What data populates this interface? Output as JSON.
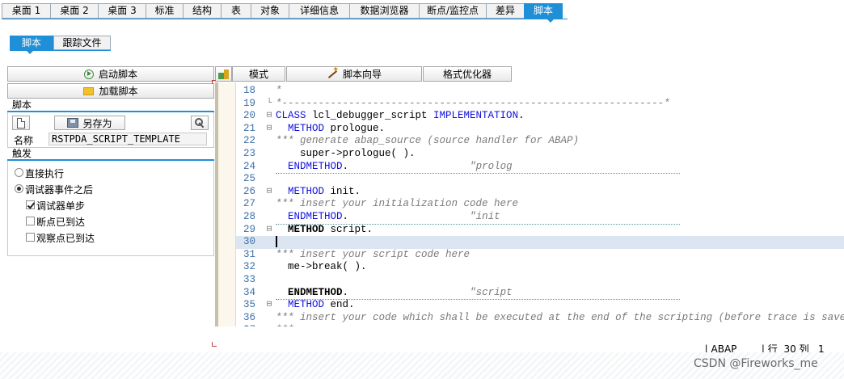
{
  "top_tabs": [
    "桌面 1",
    "桌面 2",
    "桌面 3",
    "标准",
    "结构",
    "表",
    "对象",
    "详细信息",
    "数据浏览器",
    "断点/监控点",
    "差异",
    "脚本"
  ],
  "top_tabs_active": "脚本",
  "sub_tabs": [
    "脚本",
    "跟踪文件"
  ],
  "sub_tabs_active": "脚本",
  "left": {
    "start_button": "启动脚本",
    "load_button": "加载脚本",
    "script_group": "脚本",
    "save_as_button": "另存为",
    "name_label": "名称",
    "name_value": "RSTPDA_SCRIPT_TEMPLATE",
    "trigger_group": "触发",
    "radio_direct": "直接执行",
    "radio_after_event": "调试器事件之后",
    "check_single_step": "调试器单步",
    "check_breakpoint": "断点已到达",
    "check_watchpoint": "观察点已到达",
    "selected_radio": "调试器事件之后",
    "checked": [
      "调试器单步"
    ]
  },
  "editor_toolbar": {
    "mode_button": "模式",
    "wizard_button": "脚本向导",
    "formatter_button": "格式优化器"
  },
  "code": [
    {
      "n": "18",
      "fold": "",
      "html": "<span class='cm'>*</span>"
    },
    {
      "n": "19",
      "fold": "└",
      "html": "<span class='cm'>*---------------------------------------------------------------*</span>"
    },
    {
      "n": "20",
      "fold": "⊟",
      "html": "<span class='kw'>CLASS</span> lcl_debugger_script <span class='kw'>IMPLEMENTATION</span>."
    },
    {
      "n": "21",
      "fold": "⊟",
      "html": "  <span class='kw'>METHOD</span> prologue."
    },
    {
      "n": "22",
      "fold": "",
      "html": "<span class='cm'>*** generate abap_source (source handler for ABAP)</span>"
    },
    {
      "n": "23",
      "fold": "",
      "html": "    super-&gt;prologue( )."
    },
    {
      "n": "24",
      "fold": "",
      "html": "  <span class='kw'>ENDMETHOD</span>.                    <span class='st'>\"prolog</span>",
      "dotted": true
    },
    {
      "n": "25",
      "fold": "",
      "html": ""
    },
    {
      "n": "26",
      "fold": "⊟",
      "html": "  <span class='kw'>METHOD</span> init."
    },
    {
      "n": "27",
      "fold": "",
      "html": "<span class='cm'>*** insert your initialization code here</span>"
    },
    {
      "n": "28",
      "fold": "",
      "html": "  <span class='kw'>ENDMETHOD</span>.                    <span class='st'>\"init</span>",
      "dotted": true
    },
    {
      "n": "29",
      "fold": "⊟",
      "html": "  <span class='kwb'>METHOD</span> script."
    },
    {
      "n": "30",
      "fold": "",
      "html": "<span class='cursor'></span>",
      "current": true
    },
    {
      "n": "31",
      "fold": "",
      "html": "<span class='cm'>*** insert your script code here</span>"
    },
    {
      "n": "32",
      "fold": "",
      "html": "  me-&gt;break( )."
    },
    {
      "n": "33",
      "fold": "",
      "html": ""
    },
    {
      "n": "34",
      "fold": "",
      "html": "  <span class='kwb'>ENDMETHOD</span>.                    <span class='st'>\"script</span>",
      "dotted": true
    },
    {
      "n": "35",
      "fold": "⊟",
      "html": "  <span class='kw'>METHOD</span> end."
    },
    {
      "n": "36",
      "fold": "",
      "html": "<span class='cm'>*** insert your code which shall be executed at the end of the scripting (before trace is saved)</span>"
    },
    {
      "n": "37",
      "fold": "",
      "html": "<span class='cm'>*** </span>"
    }
  ],
  "status": {
    "lang": "ABAP",
    "row_label": "行",
    "row": "30",
    "col_label": "列",
    "col": "1"
  },
  "watermark": "CSDN @Fireworks_me",
  "colors": {
    "accent": "#1f8fd7",
    "keyword": "#1010e0",
    "comment": "#7a7a7a",
    "current_line": "#dce6f2"
  }
}
